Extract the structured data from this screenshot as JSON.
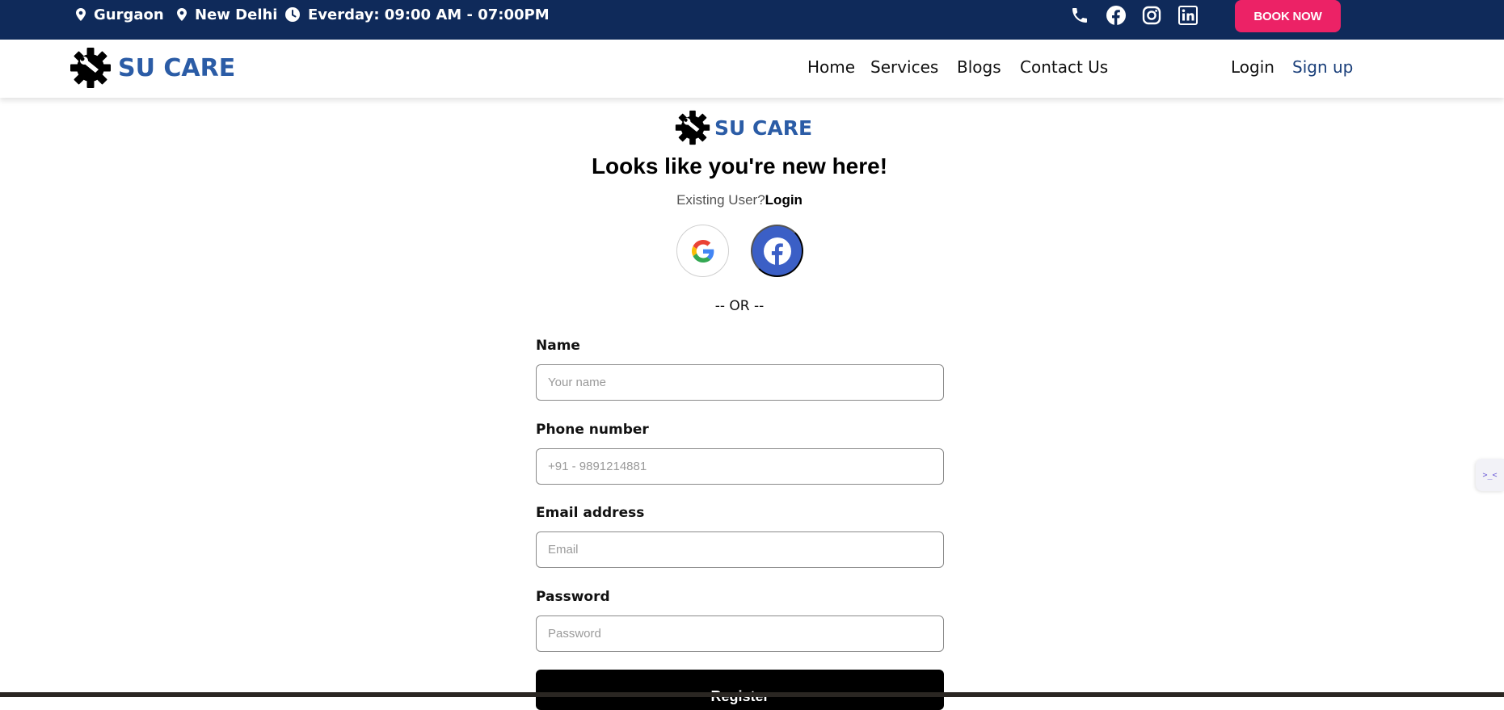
{
  "topbar": {
    "location1": "Gurgaon",
    "location2": "New Delhi",
    "hours": "Everday: 09:00 AM - 07:00PM",
    "book_now": "BOOK NOW",
    "icons": [
      "map-pin-icon",
      "clock-icon",
      "phone-icon",
      "facebook-icon",
      "instagram-icon",
      "linkedin-icon"
    ],
    "bg_color": "#0f2a5a",
    "book_color": "#ec2266"
  },
  "navbar": {
    "brand": "SU CARE",
    "links": [
      "Home",
      "Services",
      "Blogs",
      "Contact Us"
    ],
    "login": "Login",
    "signup": "Sign up"
  },
  "signup_form": {
    "brand": "SU CARE",
    "heading": "Looks like you're new here!",
    "existing_prefix": "Existing User?",
    "existing_link": "Login",
    "social_buttons": [
      "google-icon",
      "facebook-icon"
    ],
    "or_text": "-- OR --",
    "fields": [
      {
        "label": "Name",
        "placeholder": "Your name",
        "value": ""
      },
      {
        "label": "Phone number",
        "placeholder": "+91 - 9891214881",
        "value": ""
      },
      {
        "label": "Email address",
        "placeholder": "Email",
        "value": ""
      },
      {
        "label": "Password",
        "placeholder": "Password",
        "value": ""
      }
    ],
    "submit": "Register"
  },
  "side_widget": {
    "text": ">_<"
  }
}
